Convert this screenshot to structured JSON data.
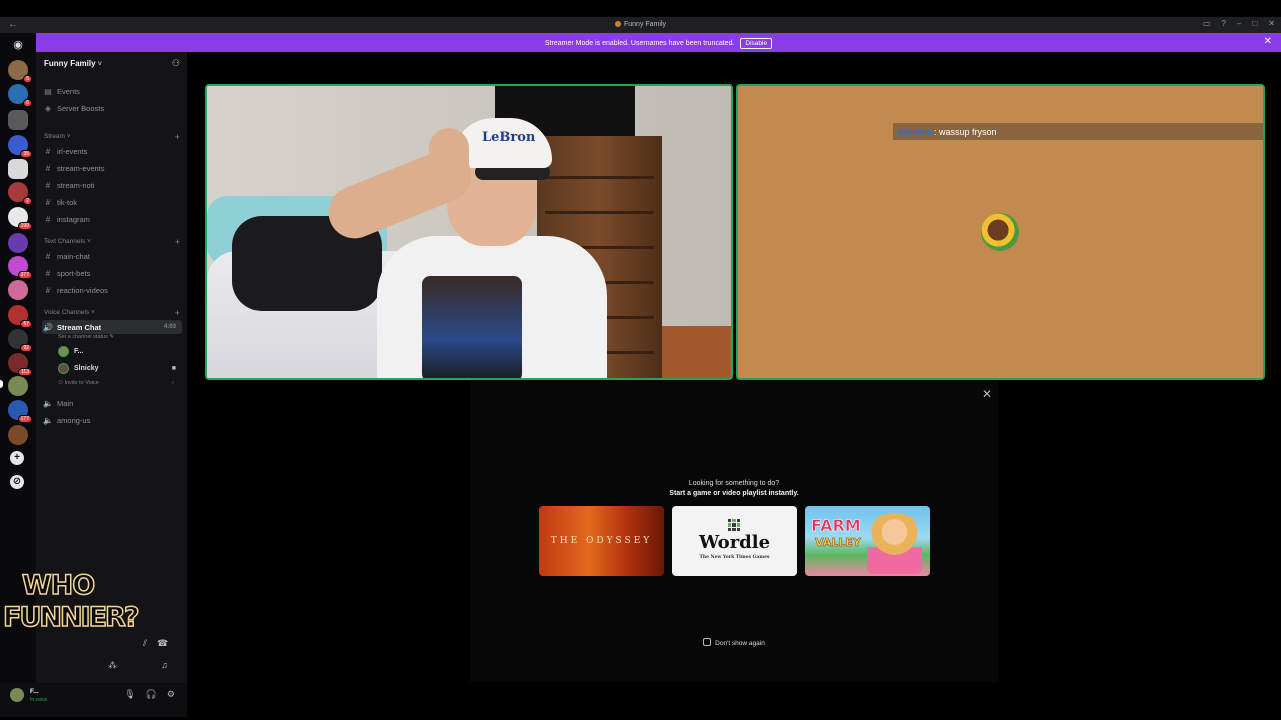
{
  "window": {
    "title": "Funny Family",
    "back_icon": "←"
  },
  "banner": {
    "message": "Streamer Mode is enabled. Usernames have been truncated.",
    "disable_label": "Disable",
    "close_icon": "✕"
  },
  "server": {
    "name": "Funny Family",
    "chevron": "˅",
    "top_items": [
      {
        "label": "Events",
        "icon": "calendar-icon"
      },
      {
        "label": "Server Boosts",
        "icon": "boost-icon"
      }
    ],
    "categories": {
      "stream": "Stream",
      "text": "Text Channels",
      "voice": "Voice Channels"
    },
    "stream_channels": [
      "irl-events",
      "stream-events",
      "stream-noti",
      "tik-tok",
      "instagram"
    ],
    "text_channels": [
      "main-chat",
      "sport-bets",
      "reaction-videos"
    ],
    "voice": {
      "active_channel": "Stream Chat",
      "active_channel_meta": "4:03",
      "status_prompt": "Set a channel status",
      "users": [
        {
          "name": "F...",
          "camera": false
        },
        {
          "name": "Slnicky",
          "camera": true
        }
      ],
      "invite_label": "Invite to Voice",
      "other_channels": [
        "Main",
        "among-us"
      ]
    }
  },
  "rail_badges": [
    "5",
    "6",
    "35",
    "2",
    "199",
    "377",
    "67",
    "92",
    "113",
    "177"
  ],
  "user_panel": {
    "name": "F...",
    "status": "In voice"
  },
  "overlay_text": {
    "line1": "WHO",
    "line2": "FUNNIER?"
  },
  "stage": {
    "chat_bubble": {
      "name": "jacobthe",
      "message": ": wassup fryson"
    },
    "activity": {
      "prompt_line1": "Looking for something to do?",
      "prompt_line2": "Start a game or video playlist instantly.",
      "cards": [
        {
          "title": "THE ODYSSEY"
        },
        {
          "title": "Wordle",
          "subtitle": "The New York Times Games"
        },
        {
          "title": "FARM",
          "subtitle": "VALLEY"
        }
      ],
      "dont_show_label": "Don't show again"
    }
  },
  "colors": {
    "accent": "#8a3ce6",
    "speaking": "#23a55a",
    "sidebar": "#141417"
  }
}
